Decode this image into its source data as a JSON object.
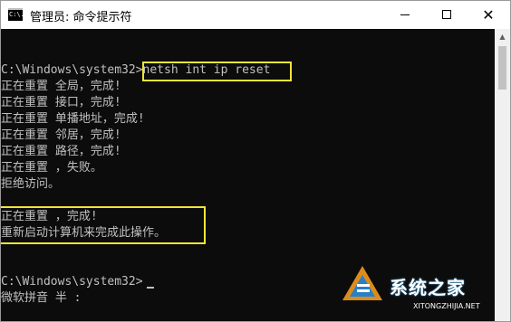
{
  "window": {
    "title": "管理员: 命令提示符",
    "icon_text": "C:\\."
  },
  "titlebar_buttons": {
    "minimize": "minimize-icon",
    "maximize": "maximize-icon",
    "close": "✕"
  },
  "console": {
    "lines": [
      "",
      "",
      "C:\\Windows\\system32>netsh int ip reset",
      "正在重置 全局，完成!",
      "正在重置 接口，完成!",
      "正在重置 单播地址，完成!",
      "正在重置 邻居，完成!",
      "正在重置 路径，完成!",
      "正在重置 ，失败。",
      "拒绝访问。",
      "",
      "正在重置 ，完成!",
      "重新启动计算机来完成此操作。",
      "",
      "",
      "C:\\Windows\\system32>",
      "微软拼音 半 :"
    ],
    "colors": {
      "background": "#0c0c0c",
      "text": "#c0c0c0",
      "highlight": "#f2e534"
    }
  },
  "scrollbar": {
    "up_arrow": "▲"
  },
  "watermark": {
    "logo": "xitongzhijia-logo-icon",
    "text": "系统之家",
    "url": "XITONGZHIJIA.NET"
  }
}
